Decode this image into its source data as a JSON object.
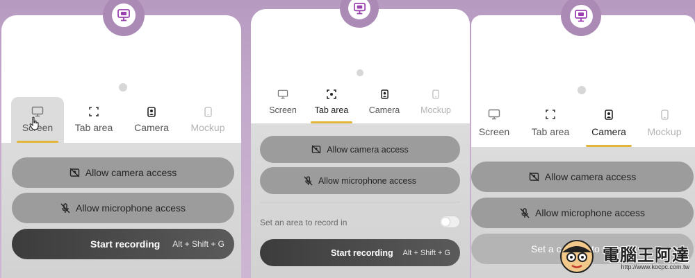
{
  "colors": {
    "accent": "#e3b53a",
    "logo_bg": "#ab8bb5",
    "logo_icon": "#9b3fb0"
  },
  "panel1": {
    "tabs": [
      {
        "label": "Screen",
        "icon": "monitor-icon"
      },
      {
        "label": "Tab area",
        "icon": "focus-frame-icon"
      },
      {
        "label": "Camera",
        "icon": "camera-portrait-icon"
      },
      {
        "label": "Mockup",
        "icon": "phone-icon"
      }
    ],
    "allow_camera": "Allow camera access",
    "allow_microphone": "Allow microphone access",
    "start_recording": "Start recording",
    "shortcut": "Alt + Shift + G"
  },
  "panel2": {
    "tabs": [
      {
        "label": "Screen",
        "icon": "monitor-icon"
      },
      {
        "label": "Tab area",
        "icon": "focus-frame-icon"
      },
      {
        "label": "Camera",
        "icon": "camera-portrait-icon"
      },
      {
        "label": "Mockup",
        "icon": "phone-icon"
      }
    ],
    "allow_camera": "Allow camera access",
    "allow_microphone": "Allow microphone access",
    "area_setting": "Set an area to record in",
    "start_recording": "Start recording",
    "shortcut": "Alt + Shift + G"
  },
  "panel3": {
    "tabs": [
      {
        "label": "Screen",
        "icon": "monitor-icon"
      },
      {
        "label": "Tab area",
        "icon": "focus-frame-icon"
      },
      {
        "label": "Camera",
        "icon": "camera-portrait-icon"
      },
      {
        "label": "Mockup",
        "icon": "phone-icon"
      }
    ],
    "allow_camera": "Allow camera access",
    "allow_microphone": "Allow microphone access",
    "set_camera": "Set a camera to record"
  },
  "watermark": {
    "title": "電腦王阿達",
    "url": "http://www.kocpc.com.tw"
  }
}
